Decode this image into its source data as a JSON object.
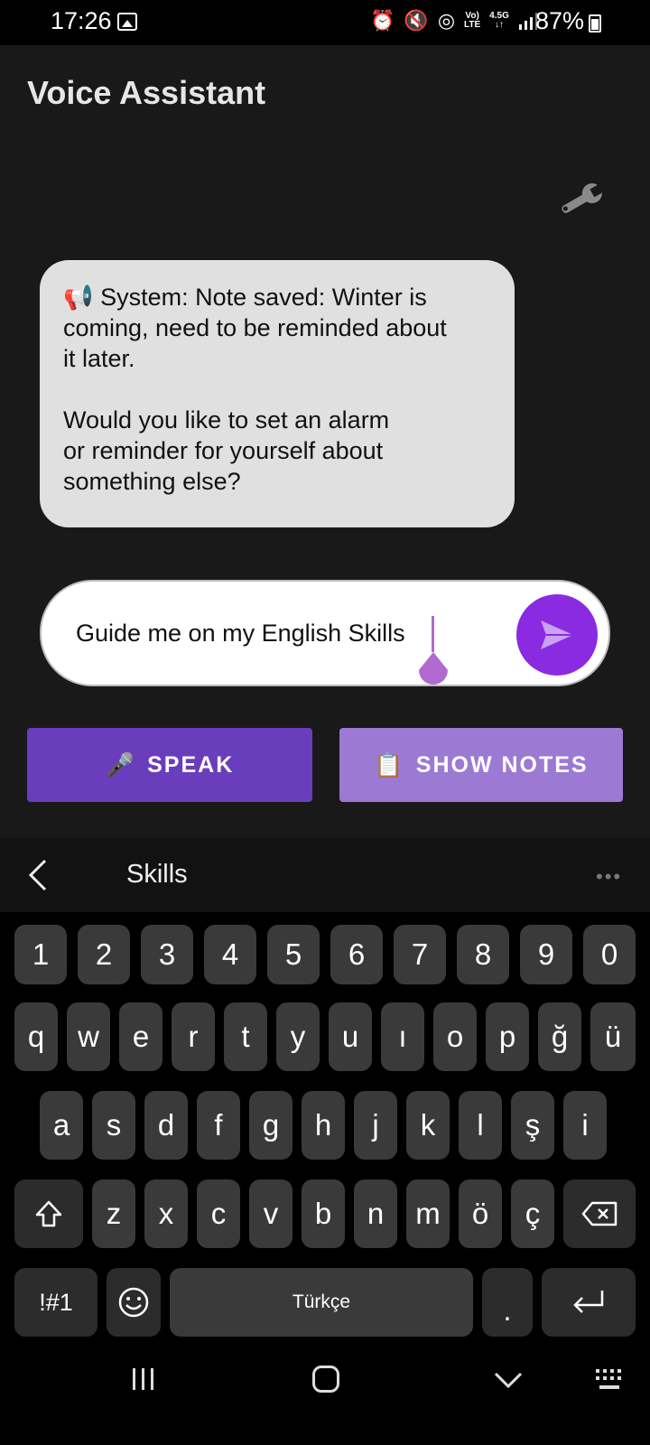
{
  "status_bar": {
    "time": "17:26",
    "battery": "87%",
    "signal_label_top": "Vo)",
    "signal_label_bottom": "LTE",
    "network": "4.5G"
  },
  "app": {
    "title": "Voice Assistant",
    "message_lines": [
      "📢 System: Note saved: Winter is",
      "coming, need to be reminded about",
      "it later.",
      " ",
      "Would you like to set an alarm",
      "or reminder for yourself about",
      "something else?"
    ],
    "input_value": "Guide me on my English Skills",
    "speak_emoji": "🎤",
    "speak_label": "SPEAK",
    "notes_emoji": "📋",
    "notes_label": "SHOW NOTES",
    "colors": {
      "send": "#8a2be2",
      "speak": "#6a3dbc",
      "notes": "#9c7ad3"
    }
  },
  "keyboard": {
    "suggestion": "Skills",
    "more": "•••",
    "row_numbers": [
      "1",
      "2",
      "3",
      "4",
      "5",
      "6",
      "7",
      "8",
      "9",
      "0"
    ],
    "row_top": [
      "q",
      "w",
      "e",
      "r",
      "t",
      "y",
      "u",
      "ı",
      "o",
      "p",
      "ğ",
      "ü"
    ],
    "row_home": [
      "a",
      "s",
      "d",
      "f",
      "g",
      "h",
      "j",
      "k",
      "l",
      "ş",
      "i"
    ],
    "row_bottom": [
      "z",
      "x",
      "c",
      "v",
      "b",
      "n",
      "m",
      "ö",
      "ç"
    ],
    "symbols_label": "!#1",
    "space_label": "Türkçe",
    "period_label": "."
  }
}
